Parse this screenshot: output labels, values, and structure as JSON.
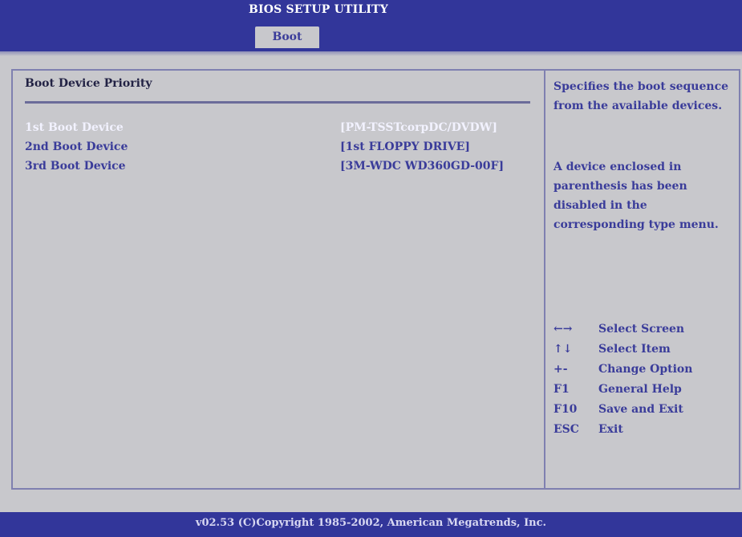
{
  "header": {
    "title": "BIOS SETUP UTILITY",
    "active_tab": "Boot"
  },
  "section": {
    "title": "Boot Device Priority"
  },
  "boot_devices": [
    {
      "label": "1st Boot Device",
      "value": "[PM-TSSTcorpDC/DVDW]"
    },
    {
      "label": "2nd Boot Device",
      "value": "[1st FLOPPY DRIVE]"
    },
    {
      "label": "3rd Boot Device",
      "value": "[3M-WDC WD360GD-00F]"
    }
  ],
  "help": {
    "line1": "Specifies the boot sequence from the available devices.",
    "line2": "A device enclosed in parenthesis has been disabled in the corresponding type menu."
  },
  "shortcuts": [
    {
      "key": "←→",
      "action": "Select Screen"
    },
    {
      "key": "↑↓",
      "action": "Select Item"
    },
    {
      "key": "+-",
      "action": "Change Option"
    },
    {
      "key": "F1",
      "action": "General Help"
    },
    {
      "key": "F10",
      "action": "Save and Exit"
    },
    {
      "key": "ESC",
      "action": "Exit"
    }
  ],
  "footer": {
    "copyright": "v02.53 (C)Copyright 1985-2002, American Megatrends, Inc."
  },
  "colors": {
    "bios_blue": "#32369a",
    "background_gray": "#c8c8cc",
    "text_blue": "#3a3c9a"
  }
}
